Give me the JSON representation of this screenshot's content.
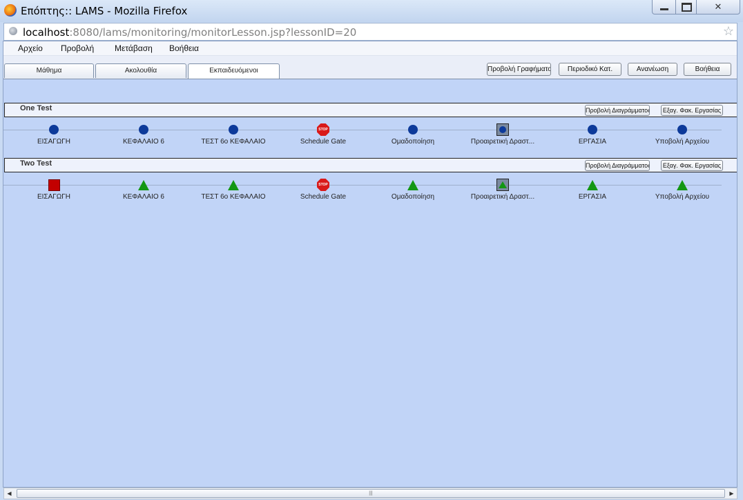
{
  "window": {
    "title": "Επόπτης:: LAMS - Mozilla Firefox",
    "url_host": "localhost",
    "url_rest": ":8080/lams/monitoring/monitorLesson.jsp?lessonID=20"
  },
  "menu": [
    "Αρχείο",
    "Προβολή",
    "Μετάβαση",
    "Βοήθεια"
  ],
  "tabs": [
    "Μάθημα",
    "Ακολουθία",
    "Εκπαιδευόμενοι"
  ],
  "active_tab": "Εκπαιδευόμενοι",
  "toolbar": {
    "graph": "Προβολή Γραφήματος",
    "periodic": "Περιοδικό Κατ.",
    "refresh": "Ανανέωση",
    "help": "Βοήθεια"
  },
  "learner_buttons": {
    "view_diagram": "Προβολή Διαγράμματος",
    "export": "Εξαγ. Φακ. Εργασίας"
  },
  "activity_labels": [
    "ΕΙΣΑΓΩΓΗ",
    "ΚΕΦΑΛΑΙΟ 6",
    "ΤΕΣΤ 6ο ΚΕΦΑΛΑΙΟ",
    "Schedule Gate",
    "Ομαδοποίηση",
    "Προαιρετική Δραστ...",
    "ΕΡΓΑΣΙΑ",
    "Υποβολή Αρχείου"
  ],
  "stop_text": "STOP",
  "learners": [
    {
      "name": "One Test",
      "statuses": [
        "completed",
        "completed",
        "completed",
        "gate",
        "completed",
        "optional-completed",
        "completed",
        "completed"
      ]
    },
    {
      "name": "Two Test",
      "statuses": [
        "current",
        "todo",
        "todo",
        "gate",
        "todo",
        "optional-todo",
        "todo",
        "todo"
      ]
    }
  ],
  "status_icons": {
    "completed": "blue-circle-icon",
    "current": "red-square-icon",
    "todo": "green-triangle-icon",
    "gate": "stop-sign-icon",
    "optional-completed": "optional-box-circle-icon",
    "optional-todo": "optional-box-triangle-icon"
  },
  "colors": {
    "page_bg": "#c1d4f7",
    "completed": "#0d3a9a",
    "current": "#c30000",
    "todo": "#139713",
    "gate": "#d91a1a"
  }
}
